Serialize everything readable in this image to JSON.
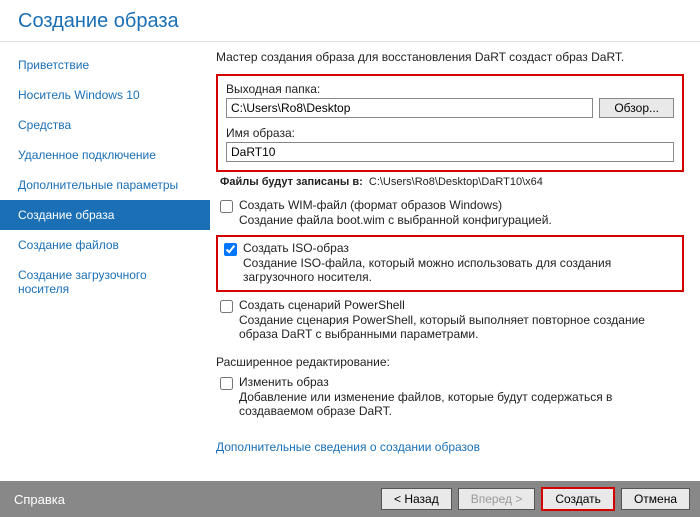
{
  "title": "Создание образа",
  "sidebar": {
    "items": [
      {
        "label": "Приветствие"
      },
      {
        "label": "Носитель Windows 10"
      },
      {
        "label": "Средства"
      },
      {
        "label": "Удаленное подключение"
      },
      {
        "label": "Дополнительные параметры"
      },
      {
        "label": "Создание образа"
      },
      {
        "label": "Создание файлов"
      },
      {
        "label": "Создание загрузочного носителя"
      }
    ],
    "activeIndex": 5
  },
  "content": {
    "intro": "Мастер создания образа для восстановления DaRT создаст образ DaRT.",
    "outFolderLabel": "Выходная папка:",
    "outFolderValue": "C:\\Users\\Ro8\\Desktop",
    "browseLabel": "Обзор...",
    "imgNameLabel": "Имя образа:",
    "imgNameValue": "DaRT10",
    "filesInPrefix": "Файлы будут записаны в:",
    "filesInPath": "C:\\Users\\Ro8\\Desktop\\DaRT10\\x64",
    "optWimTitle": "Создать WIM-файл (формат образов Windows)",
    "optWimDesc": "Создание файла boot.wim с выбранной конфигурацией.",
    "optIsoTitle": "Создать ISO-образ",
    "optIsoDesc": "Создание ISO-файла, который можно использовать для создания загрузочного носителя.",
    "optPsTitle": "Создать сценарий PowerShell",
    "optPsDesc": "Создание сценария PowerShell, который выполняет повторное создание образа DaRT с выбранными параметрами.",
    "advTitle": "Расширенное редактирование:",
    "optEditTitle": "Изменить образ",
    "optEditDesc": "Добавление или изменение файлов, которые будут содержаться в создаваемом образе DaRT.",
    "moreInfo": "Дополнительные сведения о создании образов"
  },
  "footer": {
    "help": "Справка",
    "back": "< Назад",
    "next": "Вперед >",
    "create": "Создать",
    "cancel": "Отмена"
  }
}
